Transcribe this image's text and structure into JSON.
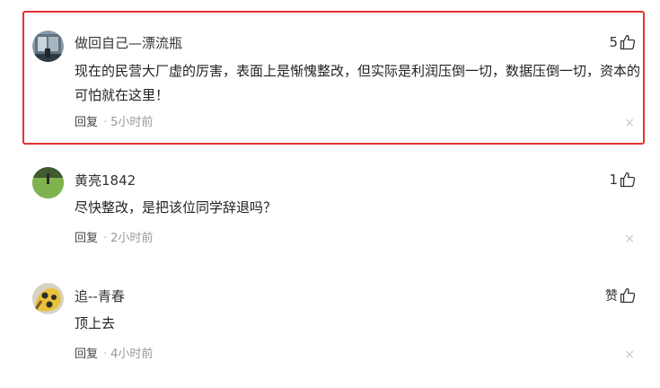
{
  "accent_color": "#e8302f",
  "comments": [
    {
      "username": "做回自己—漂流瓶",
      "text": "现在的民营大厂虚的厉害，表面上是惭愧整改，但实际是利润压倒一切，数据压倒一切，资本的可怕就在这里！",
      "reply_label": "回复",
      "separator": "·",
      "time": "5小时前",
      "likes": "5",
      "close_icon": "×",
      "highlighted": true
    },
    {
      "username": "黄亮1842",
      "text": "尽快整改，是把该位同学辞退吗？",
      "reply_label": "回复",
      "separator": "·",
      "time": "2小时前",
      "likes": "1",
      "close_icon": "×"
    },
    {
      "username": "追--青春",
      "text": "顶上去",
      "reply_label": "回复",
      "separator": "·",
      "time": "4小时前",
      "likes": "赞",
      "close_icon": "×"
    }
  ]
}
